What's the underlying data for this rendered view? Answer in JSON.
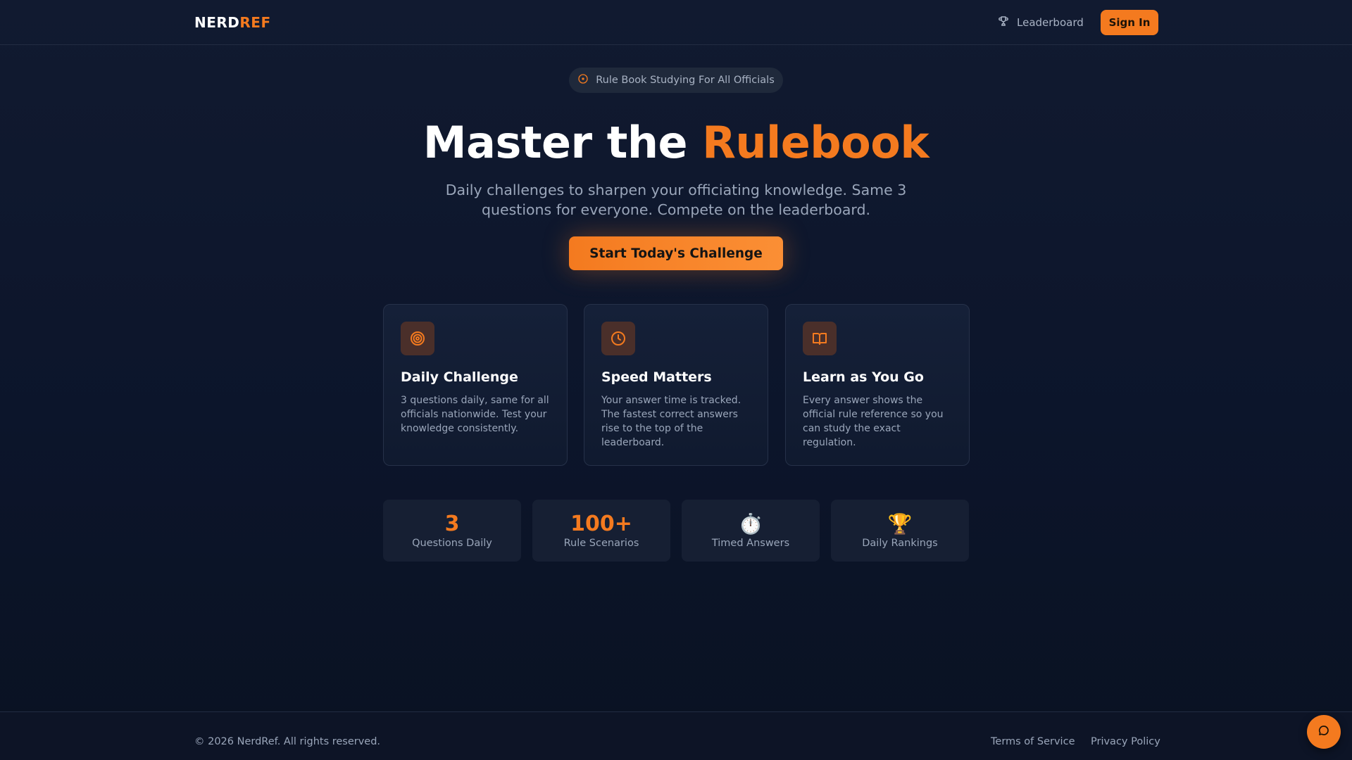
{
  "header": {
    "logo_part1": "NERD",
    "logo_part2": "REF",
    "nav_leaderboard": "Leaderboard",
    "signin_label": "Sign In"
  },
  "hero": {
    "pill_text": "Rule Book Studying For All Officials",
    "title_part1": "Master the ",
    "title_part2": "Rulebook",
    "subtitle": "Daily challenges to sharpen your officiating knowledge. Same 3 questions for everyone. Compete on the leaderboard.",
    "cta_label": "Start Today's Challenge"
  },
  "features": [
    {
      "icon": "target-icon",
      "title": "Daily Challenge",
      "description": "3 questions daily, same for all officials nationwide. Test your knowledge consistently."
    },
    {
      "icon": "clock-icon",
      "title": "Speed Matters",
      "description": "Your answer time is tracked. The fastest correct answers rise to the top of the leaderboard."
    },
    {
      "icon": "book-icon",
      "title": "Learn as You Go",
      "description": "Every answer shows the official rule reference so you can study the exact regulation."
    }
  ],
  "stats": [
    {
      "value": "3",
      "label": "Questions Daily"
    },
    {
      "value": "100+",
      "label": "Rule Scenarios"
    },
    {
      "value": "⏱️",
      "label": "Timed Answers"
    },
    {
      "value": "🏆",
      "label": "Daily Rankings"
    }
  ],
  "footer": {
    "copyright": "© 2026 NerdRef. All rights reserved.",
    "terms": "Terms of Service",
    "privacy": "Privacy Policy"
  },
  "colors": {
    "accent": "#f47a1f",
    "background": "#0c152b",
    "card": "#131d33",
    "text_muted": "#9aa6ba"
  }
}
